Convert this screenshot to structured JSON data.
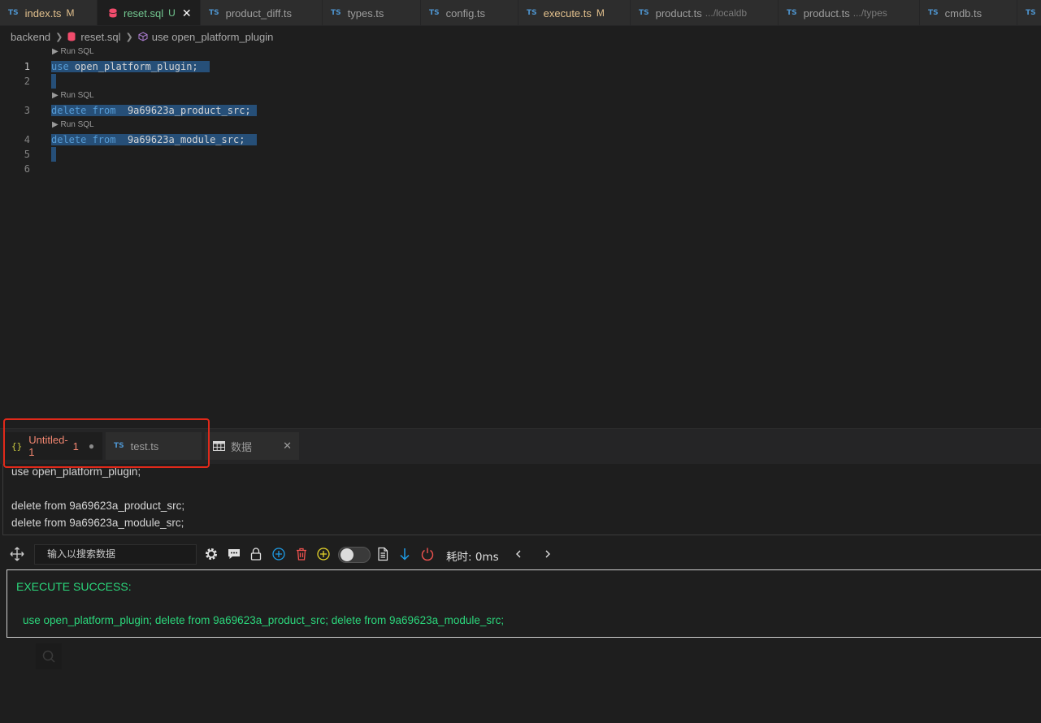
{
  "tabs": [
    {
      "name": "index.ts",
      "status": "M",
      "kind": "ts",
      "state": "modified"
    },
    {
      "name": "reset.sql",
      "status": "U",
      "kind": "sql",
      "state": "untracked",
      "active": true
    },
    {
      "name": "product_diff.ts",
      "kind": "ts"
    },
    {
      "name": "types.ts",
      "kind": "ts"
    },
    {
      "name": "config.ts",
      "kind": "ts"
    },
    {
      "name": "execute.ts",
      "status": "M",
      "kind": "ts",
      "state": "modified"
    },
    {
      "name": "product.ts",
      "desc": ".../localdb",
      "kind": "ts"
    },
    {
      "name": "product.ts",
      "desc": ".../types",
      "kind": "ts"
    },
    {
      "name": "cmdb.ts",
      "kind": "ts"
    }
  ],
  "tab_badge": "TS",
  "breadcrumb": {
    "root": "backend",
    "file": "reset.sql",
    "symbol": "use open_platform_plugin"
  },
  "editor": {
    "codelens": "Run SQL",
    "lines": {
      "n1": "1",
      "n2": "2",
      "n3": "3",
      "n4": "4",
      "n5": "5",
      "n6": "6",
      "l1_kw": "use",
      "l1_id": "open_platform_plugin;",
      "l3_kw": "delete from",
      "l3_id": "9a69623a_product_src;",
      "l4_kw": "delete from",
      "l4_id": "9a69623a_module_src;"
    }
  },
  "panel": {
    "tab1": {
      "label": "Untitled-1",
      "count": "1",
      "braces": "{}"
    },
    "tab2": {
      "label": "test.ts",
      "badge": "TS"
    },
    "tab3": {
      "label": "数据"
    },
    "query": {
      "line1": "use open_platform_plugin;",
      "line2": "delete from  9a69623a_product_src;",
      "line3": "delete from  9a69623a_module_src;"
    },
    "toolbar": {
      "search_placeholder": "输入以搜索数据",
      "timer": "耗时: 0ms"
    },
    "result": {
      "title": "EXECUTE SUCCESS:",
      "body": "use open_platform_plugin; delete from 9a69623a_product_src; delete from 9a69623a_module_src;"
    }
  },
  "colors": {
    "selection": "#264f78",
    "success": "#2bd67b",
    "highlight_box": "#e0291a",
    "modified": "#e2c08d",
    "untracked": "#73c991"
  }
}
